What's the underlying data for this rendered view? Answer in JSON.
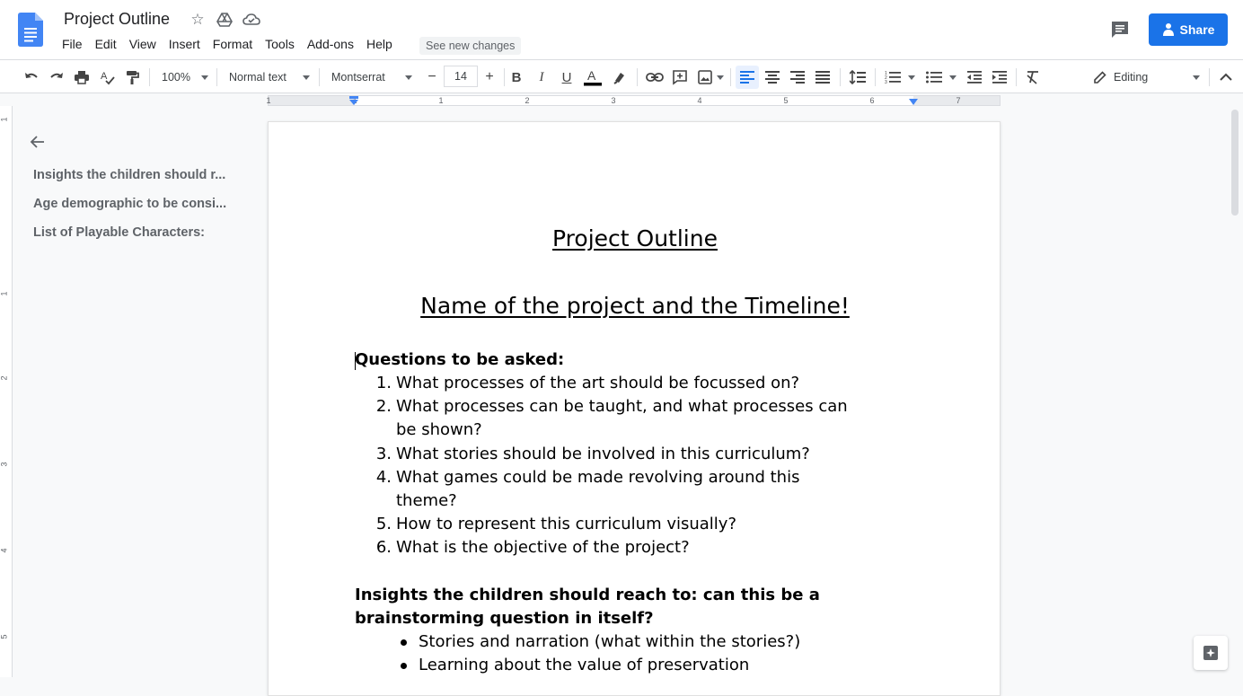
{
  "app": {
    "doc_title": "Project Outline",
    "see_new_changes": "See new changes",
    "share_label": "Share",
    "brand_color": "#4285f4",
    "share_color": "#1a73e8"
  },
  "menu": [
    "File",
    "Edit",
    "View",
    "Insert",
    "Format",
    "Tools",
    "Add-ons",
    "Help"
  ],
  "toolbar": {
    "zoom": "100%",
    "style": "Normal text",
    "font": "Montserrat",
    "font_size": "14",
    "minus": "−",
    "plus": "+",
    "mode": "Editing"
  },
  "ruler": {
    "numbers": [
      "1",
      "1",
      "1",
      "2",
      "3",
      "4",
      "5",
      "6",
      "7"
    ],
    "vertical_numbers": [
      "1",
      "1",
      "2",
      "3",
      "4",
      "5"
    ]
  },
  "outline": {
    "items": [
      "Insights the children should r...",
      "Age demographic to be consi...",
      "List of Playable Characters:"
    ]
  },
  "document": {
    "title": "Project Outline",
    "subtitle": "Name of the project and the Timeline!",
    "questions_heading": "Questions to be asked:",
    "questions": [
      {
        "num": "1.",
        "line1": "What processes of the art should be focussed on?",
        "line2": ""
      },
      {
        "num": "2.",
        "line1": "What processes can be taught, and what processes can",
        "line2": "be shown?"
      },
      {
        "num": "3.",
        "line1": "What stories should be involved in this curriculum?",
        "line2": ""
      },
      {
        "num": "4.",
        "line1": "What games could be made revolving around this",
        "line2": "theme?"
      },
      {
        "num": "5.",
        "line1": "How to represent this curriculum visually?",
        "line2": ""
      },
      {
        "num": "6.",
        "line1": "What is the objective of the project?",
        "line2": ""
      }
    ],
    "insights_heading_line1": "Insights the children should reach to: can this be a",
    "insights_heading_line2": "brainstorming question in itself?",
    "bullets": [
      "Stories and narration (what within the stories?)",
      "Learning about the value of preservation"
    ]
  }
}
